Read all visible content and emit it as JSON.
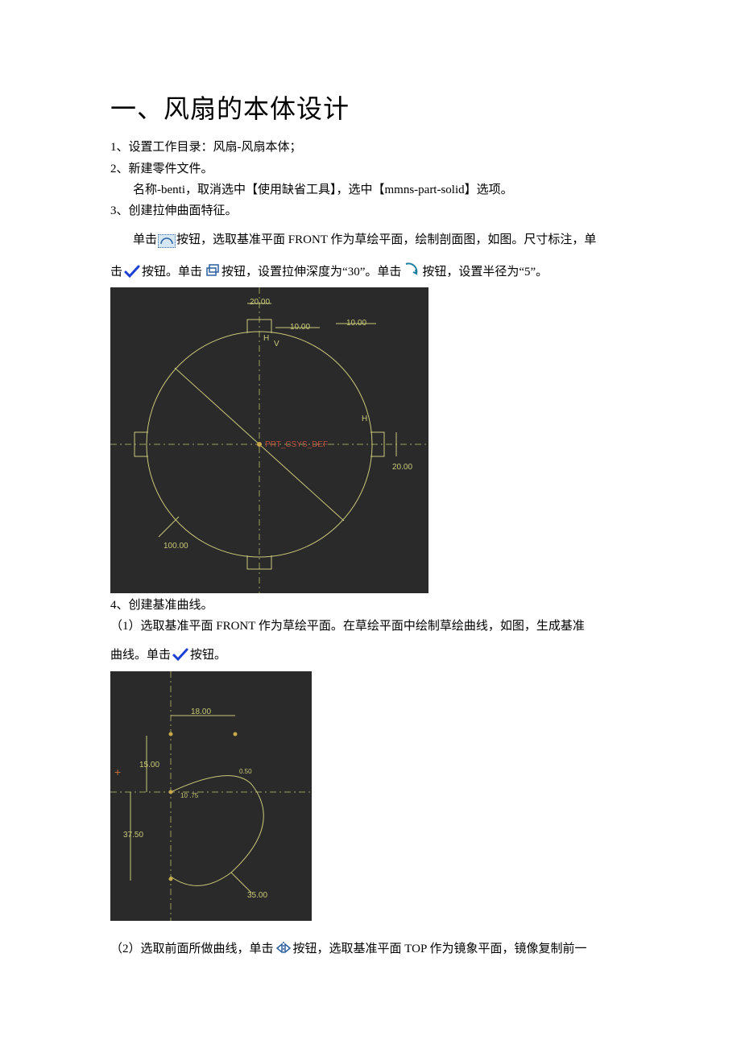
{
  "title": "一、风扇的本体设计",
  "text": {
    "s1": "1、设置工作目录：风扇-风扇本体；",
    "s2": "2、新建零件文件。",
    "s2b": "名称-benti，取消选中【使用缺省工具】，选中【mmns-part-solid】选项。",
    "s3": "3、创建拉伸曲面特征。",
    "s3a_pre": "单击",
    "s3a_post": "按钮，选取基准平面 FRONT 作为草绘平面，绘制剖面图，如图。尺寸标注，单",
    "s3b_pre": "击",
    "s3b_mid1": "按钮。单击",
    "s3b_mid2": "按钮，设置拉伸深度为“30”。单击",
    "s3b_post": "按钮，设置半径为“5”。",
    "s4": "4、创建基准曲线。",
    "s4a_pre": "（1）选取基准平面 FRONT 作为草绘平面。在草绘平面中绘制草绘曲线，如图，生成基准",
    "s4b_pre": "曲线。单击",
    "s4b_post": "按钮。",
    "s4c_pre": "（2）选取前面所做曲线，单击",
    "s4c_post": "按钮，选取基准平面 TOP 作为镜象平面，镜像复制前一"
  },
  "fig1": {
    "r": "100.00",
    "d_top": "20.00",
    "d_top_r1": "10.00",
    "d_top_r2": "10.00",
    "d_right": "20.00",
    "csys": "PRT_CSYS_DEF",
    "h1": "H",
    "h2": "H",
    "v": "V"
  },
  "fig2": {
    "d18": "18.00",
    "d15": "15.00",
    "d37": "37.50",
    "r35": "35.00",
    "rtop": "0.50",
    "ang": "10 .75"
  }
}
